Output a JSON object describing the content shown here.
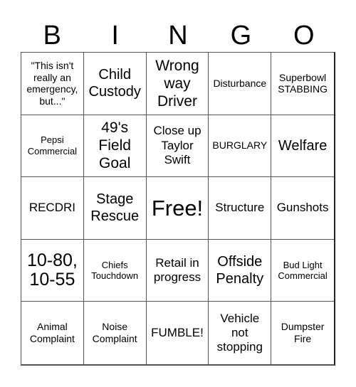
{
  "title_letters": [
    "B",
    "I",
    "N",
    "G",
    "O"
  ],
  "cells": [
    {
      "text": "\"This isn't really an emergency, but...\"",
      "size": "s-sm"
    },
    {
      "text": "Child Custody",
      "size": "s-lg"
    },
    {
      "text": "Wrong way Driver",
      "size": "s-xl"
    },
    {
      "text": "Disturbance",
      "size": "s-sm"
    },
    {
      "text": "Superbowl STABBING",
      "size": "s-sm"
    },
    {
      "text": "Pepsi Commercial",
      "size": "s-xs"
    },
    {
      "text": "49's Field Goal",
      "size": "s-xl"
    },
    {
      "text": "Close up Taylor Swift",
      "size": "s-md"
    },
    {
      "text": "BURGLARY",
      "size": "s-sm"
    },
    {
      "text": "Welfare",
      "size": "s-lg"
    },
    {
      "text": "RECDRI",
      "size": "s-md"
    },
    {
      "text": "Stage Rescue",
      "size": "s-lg"
    },
    {
      "text": "Free!",
      "size": "s-free"
    },
    {
      "text": "Structure",
      "size": "s-md"
    },
    {
      "text": "Gunshots",
      "size": "s-md"
    },
    {
      "text": "10-80, 10-55",
      "size": "s-xxl"
    },
    {
      "text": "Chiefs Touchdown",
      "size": "s-xs"
    },
    {
      "text": "Retail in progress",
      "size": "s-md"
    },
    {
      "text": "Offside Penalty",
      "size": "s-lg"
    },
    {
      "text": "Bud Light Commercial",
      "size": "s-xs"
    },
    {
      "text": "Animal Complaint",
      "size": "s-sm"
    },
    {
      "text": "Noise Complaint",
      "size": "s-sm"
    },
    {
      "text": "FUMBLE!",
      "size": "s-md"
    },
    {
      "text": "Vehicle not stopping",
      "size": "s-md"
    },
    {
      "text": "Dumpster Fire",
      "size": "s-sm"
    }
  ]
}
